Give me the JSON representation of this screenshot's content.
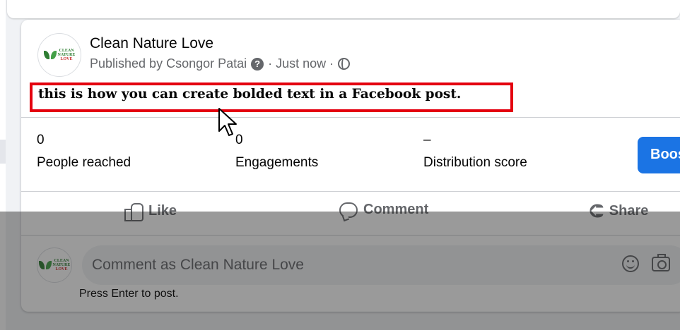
{
  "post": {
    "page_name": "Clean Nature Love",
    "published_by": "Published by Csongor Patai",
    "help_glyph": "?",
    "timestamp": "· Just now ·",
    "body_text": "this is how you can create bolded text in a Facebook post."
  },
  "logo": {
    "line1": "CLEAN",
    "line2": "NATURE",
    "line3": "LOVE"
  },
  "insights": {
    "people_reached": {
      "value": "0",
      "label": "People reached"
    },
    "engagements": {
      "value": "0",
      "label": "Engagements"
    },
    "distribution_score": {
      "value": "–",
      "label": "Distribution score"
    },
    "boost_label": "Boos"
  },
  "actions": {
    "like": "Like",
    "comment": "Comment",
    "share": "Share"
  },
  "comment_composer": {
    "placeholder": "Comment as Clean Nature Love",
    "hint": "Press Enter to post."
  },
  "icons": {
    "help": "question-circle-icon",
    "audience": "globe-icon",
    "like": "thumbs-up-icon",
    "comment": "comment-bubble-icon",
    "share": "share-arrow-icon",
    "emoji": "smiley-icon",
    "camera": "camera-icon",
    "cursor": "mouse-pointer-icon"
  },
  "colors": {
    "brand_blue": "#1b74e4",
    "highlight_red": "#e4000f",
    "secondary_text": "#65676b"
  }
}
